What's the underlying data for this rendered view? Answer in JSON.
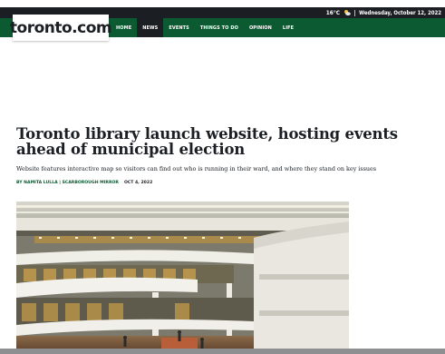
{
  "site": {
    "logo": "toronto.com"
  },
  "topbar": {
    "temperature": "16°C",
    "weather_icon": "partly-cloudy-icon",
    "date": "Wednesday, October 12, 2022"
  },
  "nav": {
    "items": [
      {
        "label": "HOME",
        "active": false
      },
      {
        "label": "NEWS",
        "active": true
      },
      {
        "label": "EVENTS",
        "active": false
      },
      {
        "label": "THINGS TO DO",
        "active": false
      },
      {
        "label": "OPINION",
        "active": false
      },
      {
        "label": "LIFE",
        "active": false
      }
    ]
  },
  "article": {
    "headline": "Toronto library launch website, hosting events ahead of municipal election",
    "subhead": "Website features interactive map so visitors can find out who is running in their ward, and where they stand on key issues",
    "author": "BY NAMITA LULLA | SCARBOROUGH MIRROR",
    "date": "OCT 4, 2022",
    "image_subject": "Toronto Reference Library interior atrium"
  },
  "colors": {
    "brand_green": "#0c5a31",
    "dark": "#1b1f24"
  }
}
